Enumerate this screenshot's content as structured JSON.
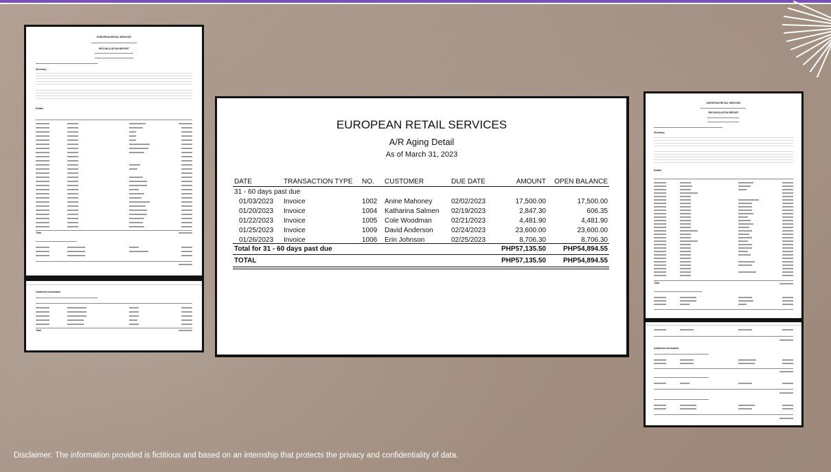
{
  "main_report": {
    "company": "EUROPEAN RETAIL SERVICES",
    "title": "A/R Aging Detail",
    "as_of": "As of March 31, 2023",
    "columns": [
      "DATE",
      "TRANSACTION TYPE",
      "NO.",
      "CUSTOMER",
      "DUE DATE",
      "AMOUNT",
      "OPEN BALANCE"
    ],
    "group_label": "31 - 60 days past due",
    "rows": [
      {
        "date": "01/03/2023",
        "type": "Invoice",
        "no": "1002",
        "customer": "Anine Mahoney",
        "due": "02/02/2023",
        "amount": "17,500.00",
        "open": "17,500.00"
      },
      {
        "date": "01/20/2023",
        "type": "Invoice",
        "no": "1004",
        "customer": "Katharina Salmen",
        "due": "02/19/2023",
        "amount": "2,847.30",
        "open": "606.35"
      },
      {
        "date": "01/22/2023",
        "type": "Invoice",
        "no": "1005",
        "customer": "Cole Woodman",
        "due": "02/21/2023",
        "amount": "4,481.90",
        "open": "4,481.90"
      },
      {
        "date": "01/25/2023",
        "type": "Invoice",
        "no": "1009",
        "customer": "David Anderson",
        "due": "02/24/2023",
        "amount": "23,600.00",
        "open": "23,600.00"
      },
      {
        "date": "01/26/2023",
        "type": "Invoice",
        "no": "1006",
        "customer": "Erin Johnson",
        "due": "02/25/2023",
        "amount": "8,706.30",
        "open": "8,706.30"
      }
    ],
    "group_total_label": "Total for 31 - 60 days past due",
    "group_total_amount": "PHP57,135.50",
    "group_total_open": "PHP54,894.55",
    "total_label": "TOTAL",
    "total_amount": "PHP57,135.50",
    "total_open": "PHP54,894.55"
  },
  "left_report": {
    "company": "EUROPEAN RETAIL SERVICES",
    "title": "RECONCILIATION REPORT",
    "summary_label": "Summary",
    "details_label": "Details",
    "total_label": "Total",
    "additional_label": "Additional information"
  },
  "right_report": {
    "company": "EUROPEAN RETAIL SERVICES",
    "title": "RECONCILIATION REPORT",
    "summary_label": "Summary",
    "details_label": "Details",
    "total_label": "Total",
    "additional_label": "Additional information"
  },
  "disclaimer": "Disclaimer: The information provided is fictitious and based on an internship that protects the privacy and confidentiality of data."
}
